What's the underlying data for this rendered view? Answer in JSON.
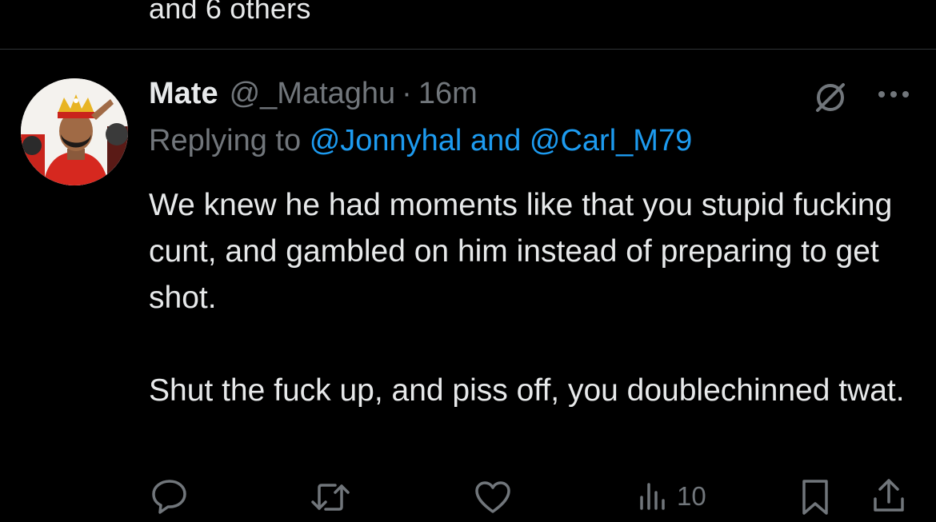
{
  "previous_tweet": {
    "liked_by_tail": "and 6 others"
  },
  "tweet": {
    "display_name": "Mate",
    "handle": "@_Mataghu",
    "separator": "·",
    "time": "16m",
    "replying_prefix": "Replying to",
    "reply_mention_1": "@Jonnyhal",
    "reply_joiner": "and",
    "reply_mention_2": "@Carl_M79",
    "text_paragraph_1": "We knew he had moments like that you stupid fucking cunt, and gambled on him instead of preparing to get shot.",
    "text_paragraph_2": "Shut the fuck up, and piss off, you doublechinned twat."
  },
  "actions": {
    "views_count": "10",
    "icons": [
      "reply-icon",
      "retweet-icon",
      "like-icon",
      "views-icon",
      "bookmark-icon",
      "share-icon"
    ]
  },
  "colors": {
    "background": "#000000",
    "text_primary": "#e7e9ea",
    "text_secondary": "#71767b",
    "accent": "#1d9bf0",
    "divider": "#2f3336"
  }
}
